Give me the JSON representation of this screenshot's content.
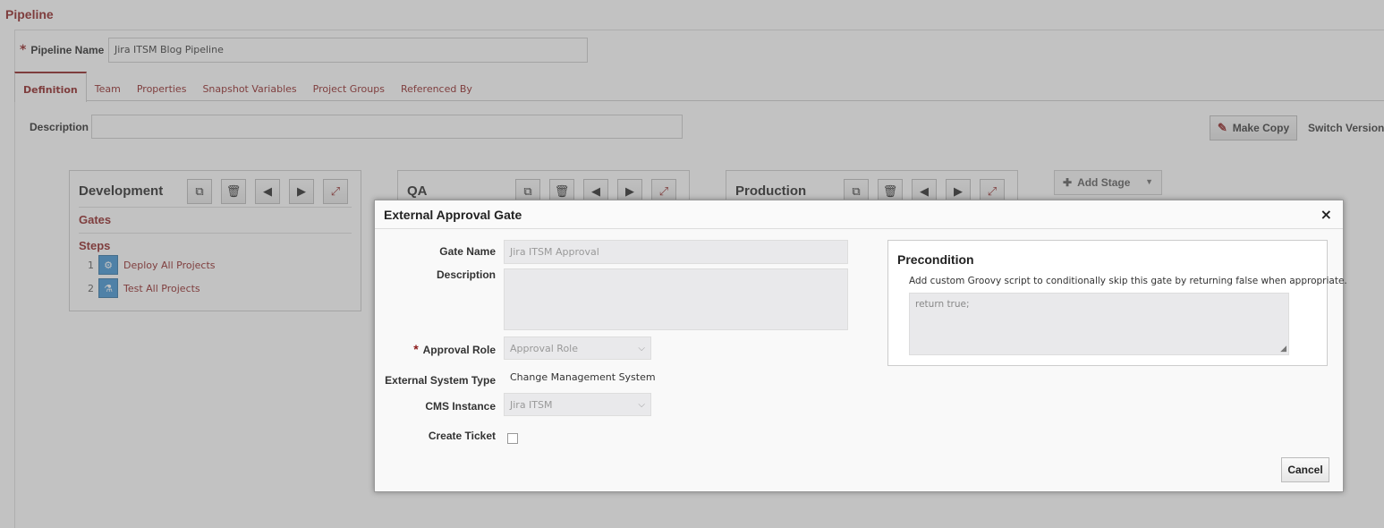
{
  "page": {
    "title": "Pipeline",
    "pipeline_name_label": "Pipeline Name",
    "pipeline_name_value": "Jira ITSM Blog Pipeline",
    "required_marker": "*",
    "tabs": [
      {
        "label": "Definition",
        "active": true
      },
      {
        "label": "Team"
      },
      {
        "label": "Properties"
      },
      {
        "label": "Snapshot Variables"
      },
      {
        "label": "Project Groups"
      },
      {
        "label": "Referenced By"
      }
    ],
    "description_label": "Description",
    "description_value": "",
    "make_copy_label": "Make Copy",
    "switch_version_label": "Switch Version",
    "add_stage_label": "Add Stage"
  },
  "stages": [
    {
      "name": "Development",
      "gates_label": "Gates",
      "steps_label": "Steps",
      "steps": [
        {
          "num": "1",
          "label": "Deploy All Projects",
          "icon": "deploy-step-icon"
        },
        {
          "num": "2",
          "label": "Test All Projects",
          "icon": "test-step-icon"
        }
      ]
    },
    {
      "name": "QA"
    },
    {
      "name": "Production"
    }
  ],
  "modal": {
    "title": "External Approval Gate",
    "close_glyph": "×",
    "gate_name_label": "Gate Name",
    "gate_name_value": "Jira ITSM Approval",
    "description_label": "Description",
    "description_value": "",
    "required_marker": "*",
    "approval_role_label": "Approval Role",
    "approval_role_value": "Approval Role",
    "external_system_type_label": "External System Type",
    "external_system_type_value": "Change Management System",
    "cms_instance_label": "CMS Instance",
    "cms_instance_value": "Jira ITSM",
    "create_ticket_label": "Create Ticket",
    "create_ticket_checked": false,
    "precondition": {
      "title": "Precondition",
      "help": "Add custom Groovy script to conditionally skip this gate by returning false when appropriate.",
      "script": "return true;"
    },
    "cancel_label": "Cancel"
  },
  "colors": {
    "accent": "#8b1a1a",
    "field_bg": "#e9e9eb",
    "step_icon": "#3a8fd0"
  }
}
